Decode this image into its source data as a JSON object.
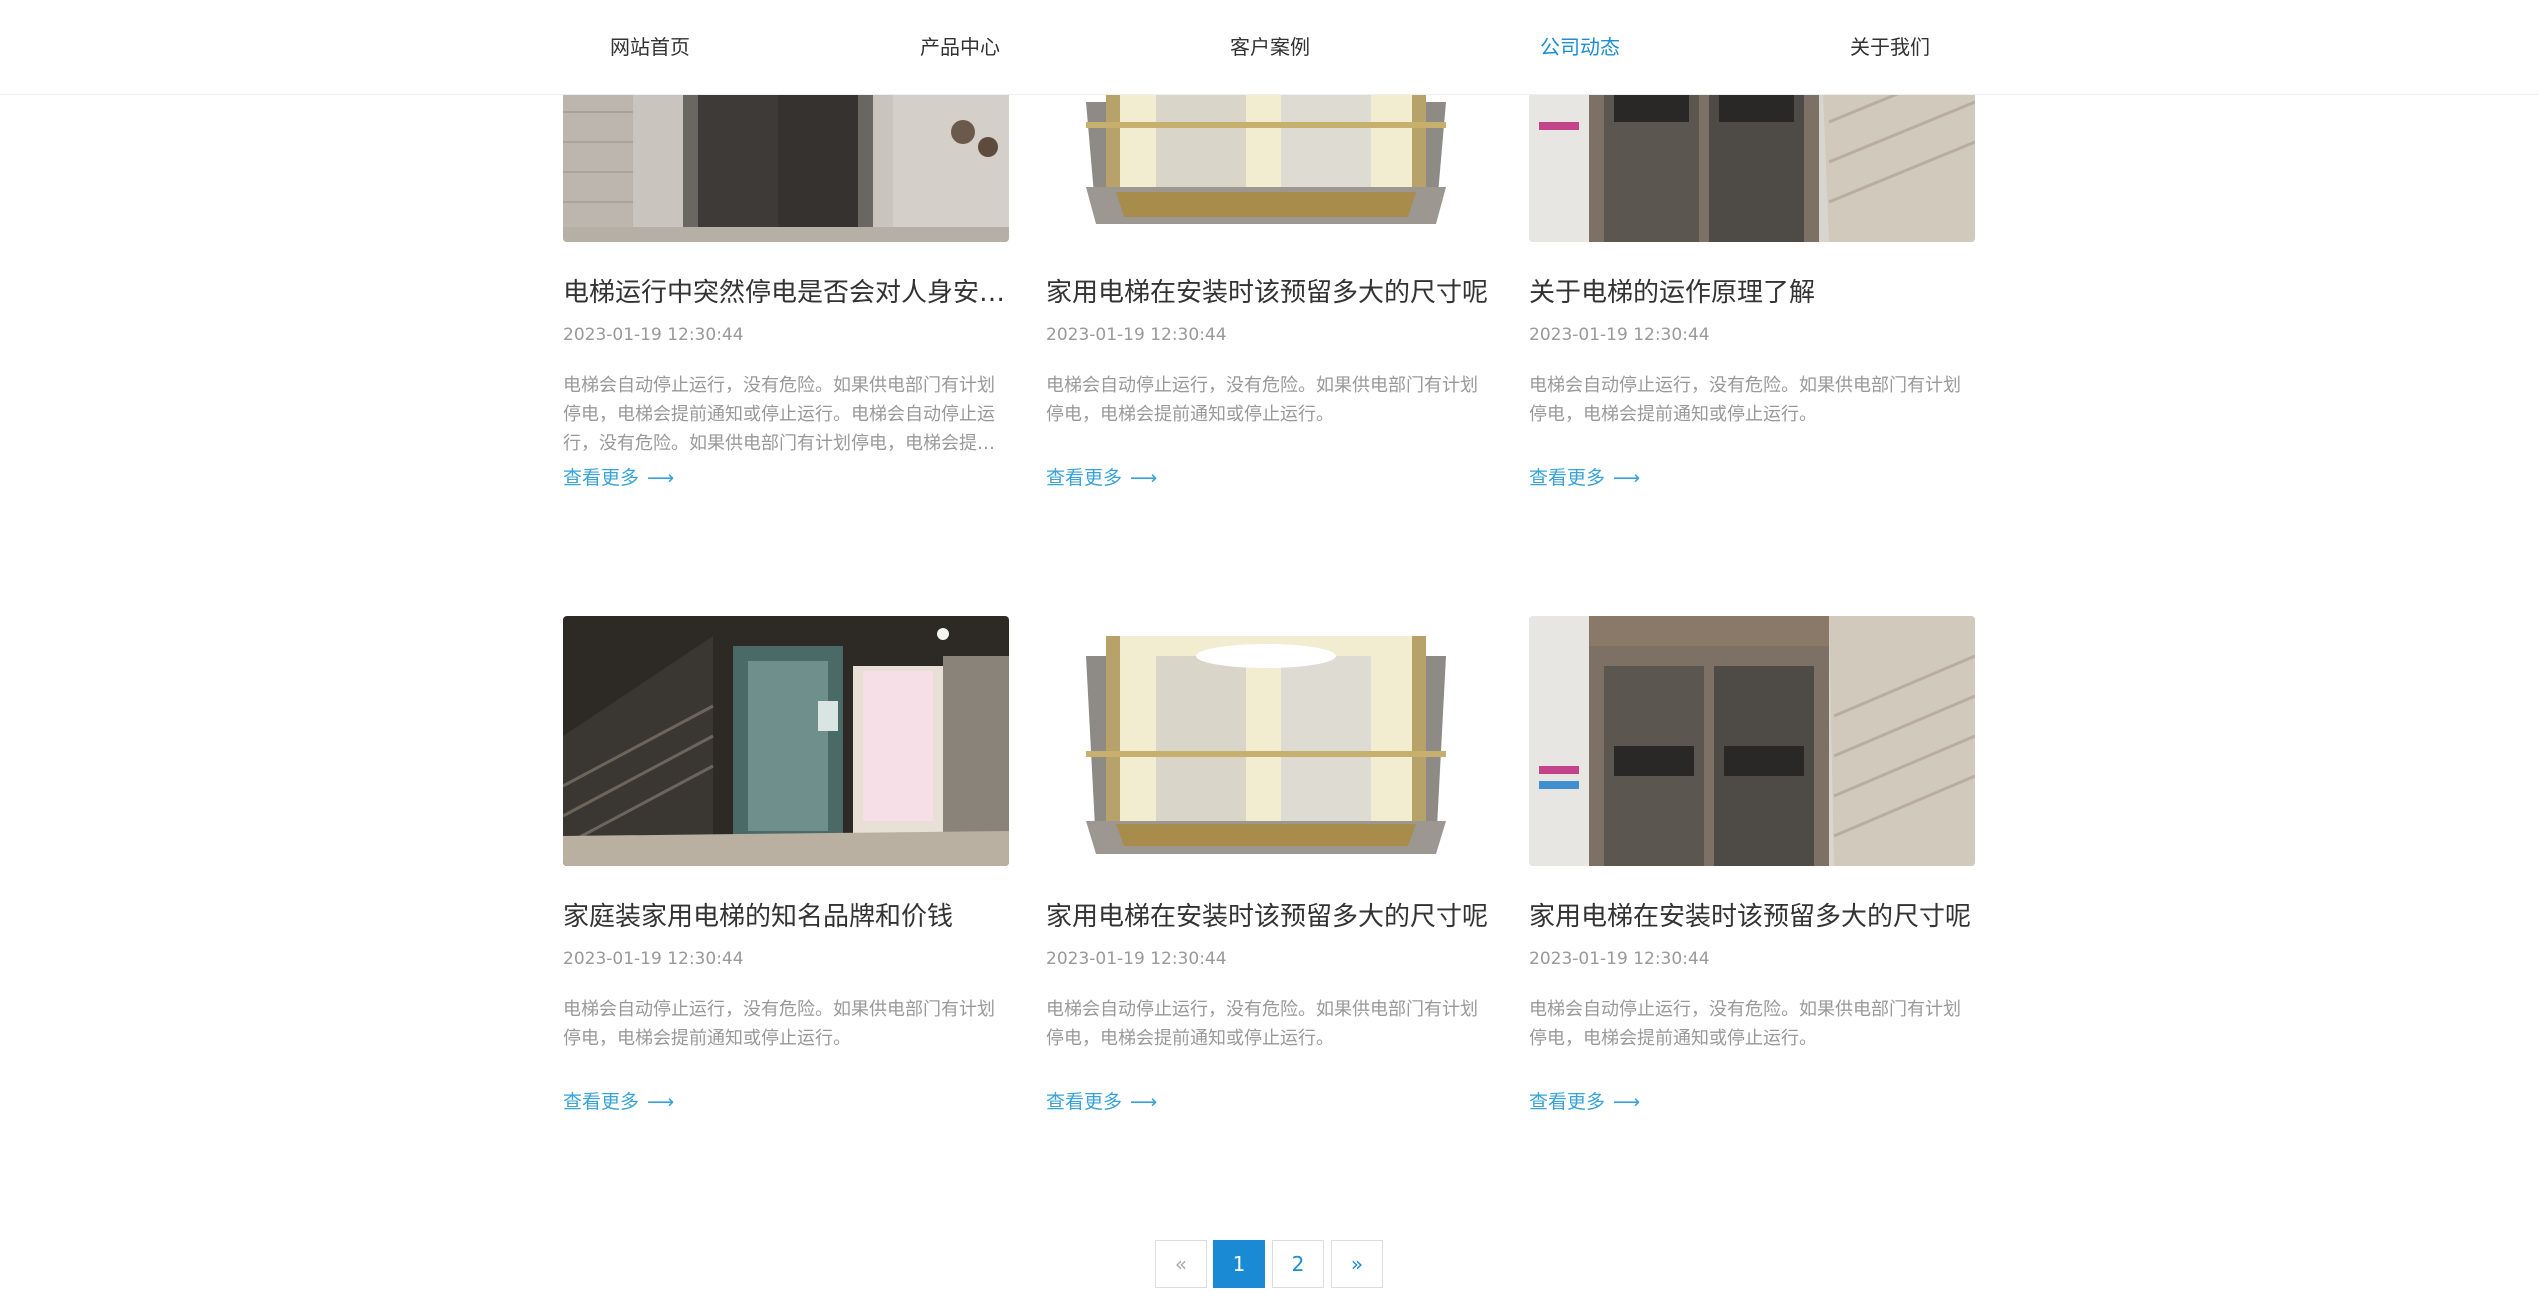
{
  "nav": {
    "items": [
      {
        "label": "网站首页"
      },
      {
        "label": "产品中心"
      },
      {
        "label": "客户案例"
      },
      {
        "label": "公司动态"
      },
      {
        "label": "关于我们"
      }
    ],
    "active": "公司动态",
    "active_color": "#1c8fd2"
  },
  "articles": [
    {
      "title": "电梯运行中突然停电是否会对人身安全...",
      "date": "2023-01-19 12:30:44",
      "excerpt": "电梯会自动停止运行，没有危险。如果供电部门有计划停电，电梯会提前通知或停止运行。电梯会自动停止运行，没有危险。如果供电部门有计划停电，电梯会提前通知...",
      "more": "查看更多"
    },
    {
      "title": "家用电梯在安装时该预留多大的尺寸呢",
      "date": "2023-01-19 12:30:44",
      "excerpt": "电梯会自动停止运行，没有危险。如果供电部门有计划停电，电梯会提前通知或停止运行。",
      "more": "查看更多"
    },
    {
      "title": "关于电梯的运作原理了解",
      "date": "2023-01-19 12:30:44",
      "excerpt": "电梯会自动停止运行，没有危险。如果供电部门有计划停电，电梯会提前通知或停止运行。",
      "more": "查看更多"
    },
    {
      "title": "家庭装家用电梯的知名品牌和价钱",
      "date": "2023-01-19 12:30:44",
      "excerpt": "电梯会自动停止运行，没有危险。如果供电部门有计划停电，电梯会提前通知或停止运行。",
      "more": "查看更多"
    },
    {
      "title": "家用电梯在安装时该预留多大的尺寸呢",
      "date": "2023-01-19 12:30:44",
      "excerpt": "电梯会自动停止运行，没有危险。如果供电部门有计划停电，电梯会提前通知或停止运行。",
      "more": "查看更多"
    },
    {
      "title": "家用电梯在安装时该预留多大的尺寸呢",
      "date": "2023-01-19 12:30:44",
      "excerpt": "电梯会自动停止运行，没有危险。如果供电部门有计划停电，电梯会提前通知或停止运行。",
      "more": "查看更多"
    }
  ],
  "pagination": {
    "prev": "«",
    "pages": [
      "1",
      "2"
    ],
    "current": "1",
    "next": "»"
  },
  "colors": {
    "accent": "#1c8fd2",
    "link": "#3aa3d8",
    "muted_text": "#999999"
  }
}
